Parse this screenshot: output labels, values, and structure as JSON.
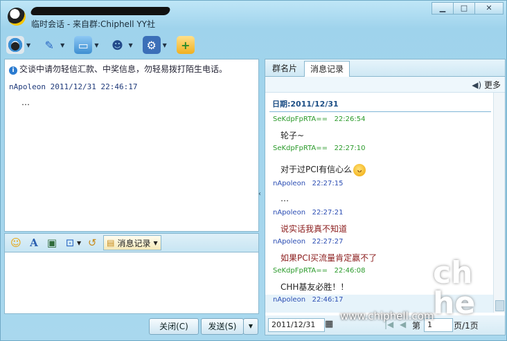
{
  "title": {
    "subtitle": "临时会话 - 来自群:Chiphell YY社",
    "buttons": [
      "▁",
      "□",
      "✕"
    ]
  },
  "toolbar": {
    "icons": [
      "video-icon",
      "microphone-icon",
      "folder-icon",
      "contact-icon",
      "settings-icon",
      "add-app-icon"
    ]
  },
  "conversation": {
    "notice": "交谈中请勿轻信汇款、中奖信息，勿轻易拨打陌生电话。",
    "messages": [
      {
        "sender": "nApoleon",
        "time": "2011/12/31 22:46:17",
        "text": "…"
      }
    ]
  },
  "inputbar": {
    "history_label": "消息记录"
  },
  "buttons": {
    "close": "关闭(C)",
    "send": "发送(S)"
  },
  "sidepanel": {
    "tabs": [
      "群名片",
      "消息记录"
    ],
    "more": "更多",
    "date_header": "日期:2011/12/31",
    "log": [
      {
        "sender": "SeKdpFpRTA==",
        "time": "22:26:54",
        "text": "轮子~"
      },
      {
        "sender": "SeKdpFpRTA==",
        "time": "22:27:10",
        "text": "对于过PCI有信心么"
      },
      {
        "sender": "nApoleon",
        "time": "22:27:15",
        "text": "…"
      },
      {
        "sender": "nApoleon",
        "time": "22:27:21",
        "text": "说实话我真不知道"
      },
      {
        "sender": "nApoleon",
        "time": "22:27:27",
        "text": "如果PCI买流量肯定赢不了"
      },
      {
        "sender": "SeKdpFpRTA==",
        "time": "22:46:08",
        "text": "CHH基友必胜！！"
      },
      {
        "sender": "nApoleon",
        "time": "22:46:17",
        "text": ""
      }
    ],
    "pager": {
      "date": "2011/12/31",
      "prefix": "第",
      "page": "1",
      "suffix": "页/1页"
    }
  },
  "watermark": {
    "url": "www.chiphell.com",
    "logo": "chip hell"
  },
  "colors": {
    "sender_other": "#2a9a2a",
    "sender_self": "#2b4db3",
    "text_self": "#8b1c1c"
  }
}
